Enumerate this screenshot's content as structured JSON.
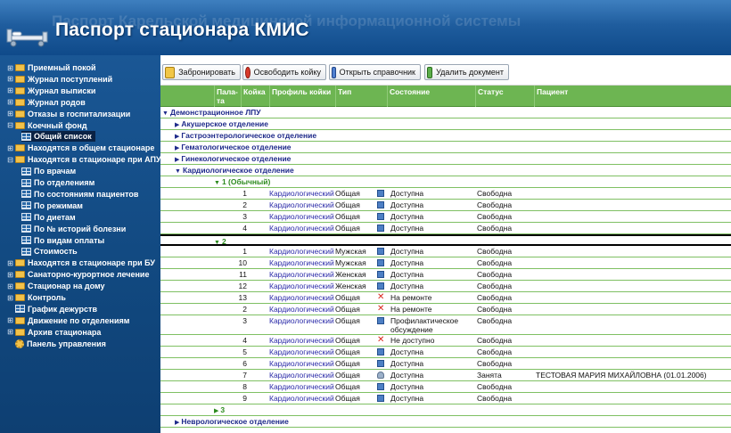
{
  "header": {
    "title": "Паспорт стационара КМИС",
    "ghost_text": "Паспорт Карельской медицинской информационной системы"
  },
  "sidebar": {
    "items": [
      {
        "label": "Приемный покой",
        "expand": "⊞",
        "icon": "folder-icon"
      },
      {
        "label": "Журнал поступлений",
        "expand": "⊞",
        "icon": "folder-icon"
      },
      {
        "label": "Журнал выписки",
        "expand": "⊞",
        "icon": "folder-icon"
      },
      {
        "label": "Журнал родов",
        "expand": "⊞",
        "icon": "folder-icon"
      },
      {
        "label": "Отказы в госпитализации",
        "expand": "⊞",
        "icon": "folder-icon"
      },
      {
        "label": "Коечный фонд",
        "expand": "⊟",
        "icon": "folder-icon"
      },
      {
        "label": "Общий список",
        "expand": "",
        "icon": "grid-icon",
        "selected": true
      },
      {
        "label": "Находятся в общем стационаре",
        "expand": "⊞",
        "icon": "folder-icon"
      },
      {
        "label": "Находятся в стационаре при АПУ",
        "expand": "⊟",
        "icon": "folder-icon"
      },
      {
        "label": "По врачам",
        "expand": "",
        "icon": "grid-icon"
      },
      {
        "label": "По отделениям",
        "expand": "",
        "icon": "grid-icon"
      },
      {
        "label": "По состояниям пациентов",
        "expand": "",
        "icon": "grid-icon"
      },
      {
        "label": "По режимам",
        "expand": "",
        "icon": "grid-icon"
      },
      {
        "label": "По диетам",
        "expand": "",
        "icon": "grid-icon"
      },
      {
        "label": "По № историй болезни",
        "expand": "",
        "icon": "grid-icon"
      },
      {
        "label": "По видам оплаты",
        "expand": "",
        "icon": "grid-icon"
      },
      {
        "label": "Стоимость",
        "expand": "",
        "icon": "grid-icon"
      },
      {
        "label": "Находятся в стационаре при БУ",
        "expand": "⊞",
        "icon": "folder-icon"
      },
      {
        "label": "Санаторно-курортное лечение",
        "expand": "⊞",
        "icon": "folder-icon"
      },
      {
        "label": "Стационар на дому",
        "expand": "⊞",
        "icon": "folder-icon"
      },
      {
        "label": "Контроль",
        "expand": "⊞",
        "icon": "folder-icon"
      },
      {
        "label": "График дежурств",
        "expand": "",
        "icon": "grid-icon"
      },
      {
        "label": "Движение по отделениям",
        "expand": "⊞",
        "icon": "folder-icon"
      },
      {
        "label": "Архив стационара",
        "expand": "⊞",
        "icon": "folder-icon"
      },
      {
        "label": "Панель управления",
        "expand": "",
        "icon": "gear-icon"
      }
    ]
  },
  "toolbar": {
    "reserve": "Забронировать",
    "release": "Освободить койку",
    "open_ref": "Открыть справочник",
    "delete_doc": "Удалить документ"
  },
  "grid": {
    "columns": {
      "ward": "Пала-та",
      "bed": "Койка",
      "profile": "Профиль койки",
      "type": "Тип",
      "state": "Состояние",
      "status": "Статус",
      "patient": "Пациент"
    },
    "groups": {
      "lpu": "Демонстрационное ЛПУ",
      "dept1": "Акушерское отделение",
      "dept2": "Гастроэнтерологическое отделение",
      "dept3": "Гематологическое отделение",
      "dept4": "Гинекологическое отделение",
      "dept5": "Кардиологическое отделение",
      "ward1": "1 (Обычный)",
      "ward2": "2",
      "ward3": "3",
      "dept6": "Неврологическое отделение"
    },
    "ward1_rows": [
      {
        "bed": "1",
        "profile": "Кардиологический",
        "type": "Общая",
        "icon": "ok",
        "state": "Доступна",
        "status": "Свободна",
        "patient": ""
      },
      {
        "bed": "2",
        "profile": "Кардиологический",
        "type": "Общая",
        "icon": "ok",
        "state": "Доступна",
        "status": "Свободна",
        "patient": ""
      },
      {
        "bed": "3",
        "profile": "Кардиологический",
        "type": "Общая",
        "icon": "ok",
        "state": "Доступна",
        "status": "Свободна",
        "patient": ""
      },
      {
        "bed": "4",
        "profile": "Кардиологический",
        "type": "Общая",
        "icon": "ok",
        "state": "Доступна",
        "status": "Свободна",
        "patient": ""
      }
    ],
    "ward2_rows": [
      {
        "bed": "1",
        "profile": "Кардиологический",
        "type": "Мужская",
        "icon": "ok",
        "state": "Доступна",
        "status": "Свободна",
        "patient": ""
      },
      {
        "bed": "10",
        "profile": "Кардиологический",
        "type": "Мужская",
        "icon": "ok",
        "state": "Доступна",
        "status": "Свободна",
        "patient": ""
      },
      {
        "bed": "11",
        "profile": "Кардиологический",
        "type": "Женская",
        "icon": "ok",
        "state": "Доступна",
        "status": "Свободна",
        "patient": ""
      },
      {
        "bed": "12",
        "profile": "Кардиологический",
        "type": "Женская",
        "icon": "ok",
        "state": "Доступна",
        "status": "Свободна",
        "patient": ""
      },
      {
        "bed": "13",
        "profile": "Кардиологический",
        "type": "Общая",
        "icon": "bad",
        "state": "На ремонте",
        "status": "Свободна",
        "patient": ""
      },
      {
        "bed": "2",
        "profile": "Кардиологический",
        "type": "Общая",
        "icon": "bad",
        "state": "На ремонте",
        "status": "Свободна",
        "patient": ""
      },
      {
        "bed": "3",
        "profile": "Кардиологический",
        "type": "Общая",
        "icon": "ok",
        "state": "Профилактическое обсуждение",
        "status": "Свободна",
        "patient": "",
        "tall": true
      },
      {
        "bed": "4",
        "profile": "Кардиологический",
        "type": "Общая",
        "icon": "bad",
        "state": "Не доступно",
        "status": "Свободна",
        "patient": ""
      },
      {
        "bed": "5",
        "profile": "Кардиологический",
        "type": "Общая",
        "icon": "ok",
        "state": "Доступна",
        "status": "Свободна",
        "patient": ""
      },
      {
        "bed": "6",
        "profile": "Кардиологический",
        "type": "Общая",
        "icon": "ok",
        "state": "Доступна",
        "status": "Свободна",
        "patient": ""
      },
      {
        "bed": "7",
        "profile": "Кардиологический",
        "type": "Общая",
        "icon": "person",
        "state": "Доступна",
        "status": "Занята",
        "patient": "ТЕСТОВАЯ МАРИЯ МИХАЙЛОВНА (01.01.2006)"
      },
      {
        "bed": "8",
        "profile": "Кардиологический",
        "type": "Общая",
        "icon": "ok",
        "state": "Доступна",
        "status": "Свободна",
        "patient": ""
      },
      {
        "bed": "9",
        "profile": "Кардиологический",
        "type": "Общая",
        "icon": "ok",
        "state": "Доступна",
        "status": "Свободна",
        "patient": ""
      }
    ]
  },
  "colors": {
    "header_bg": "#1f5d9e",
    "sidebar_bg": "#11487f",
    "grid_header": "#6db552",
    "group_text": "#1e2a8a",
    "ward_text": "#2c8a1e"
  }
}
